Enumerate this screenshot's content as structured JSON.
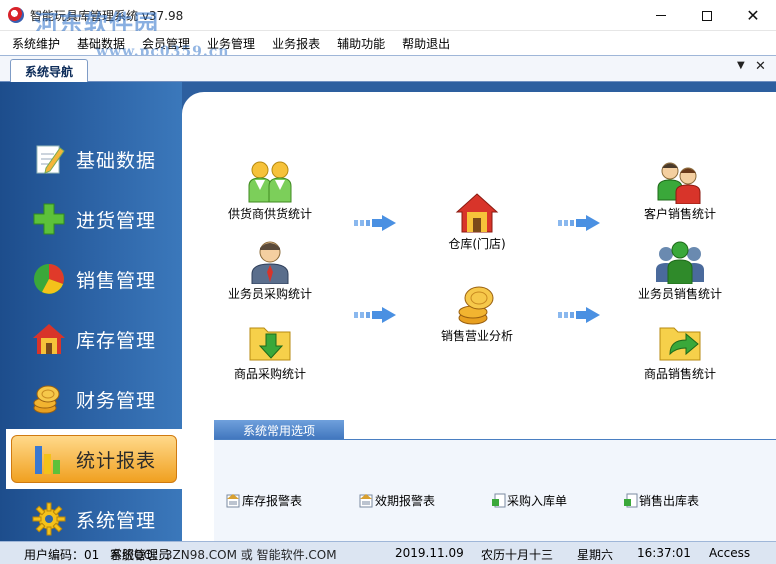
{
  "window": {
    "title": "智能玩具库管理系统 v37.98",
    "watermark": "河东软件园",
    "watermark_url": "www.pc0359.cn"
  },
  "menu": [
    "系统维护",
    "基础数据",
    "会员管理",
    "业务管理",
    "业务报表",
    "辅助功能",
    "帮助退出"
  ],
  "tab": {
    "label": "系统导航"
  },
  "sidebar": {
    "items": [
      {
        "label": "基础数据",
        "icon": "pencil-note-icon"
      },
      {
        "label": "进货管理",
        "icon": "green-plus-icon"
      },
      {
        "label": "销售管理",
        "icon": "pie-chart-icon"
      },
      {
        "label": "库存管理",
        "icon": "house-icon"
      },
      {
        "label": "财务管理",
        "icon": "coins-icon"
      },
      {
        "label": "统计报表",
        "icon": "bar-chart-icon",
        "active": true
      },
      {
        "label": "系统管理",
        "icon": "gear-icon"
      }
    ]
  },
  "features": {
    "supplier": "供货商供货统计",
    "salesman_purchase": "业务员采购统计",
    "product_purchase": "商品采购统计",
    "warehouse": "仓库(门店)",
    "sales_analysis": "销售营业分析",
    "customer_sales": "客户销售统计",
    "salesman_sales": "业务员销售统计",
    "product_sales": "商品销售统计"
  },
  "quick": {
    "title": "系统常用选项",
    "links": [
      "库存报警表",
      "效期报警表",
      "采购入库单",
      "销售出库表"
    ]
  },
  "status": {
    "user_code": "用户编码：01",
    "operator": "系统管理员",
    "contact": "客服QQ：3ZN98.COM 或 智能软件.COM",
    "date": "2019.11.09",
    "lunar": "农历十月十三",
    "weekday": "星期六",
    "time": "16:37:01",
    "db": "Access"
  },
  "colors": {
    "sidebar_blue": "#2d5f9f",
    "active_orange": "#f0a020",
    "arrow_blue": "#4a90e2"
  }
}
